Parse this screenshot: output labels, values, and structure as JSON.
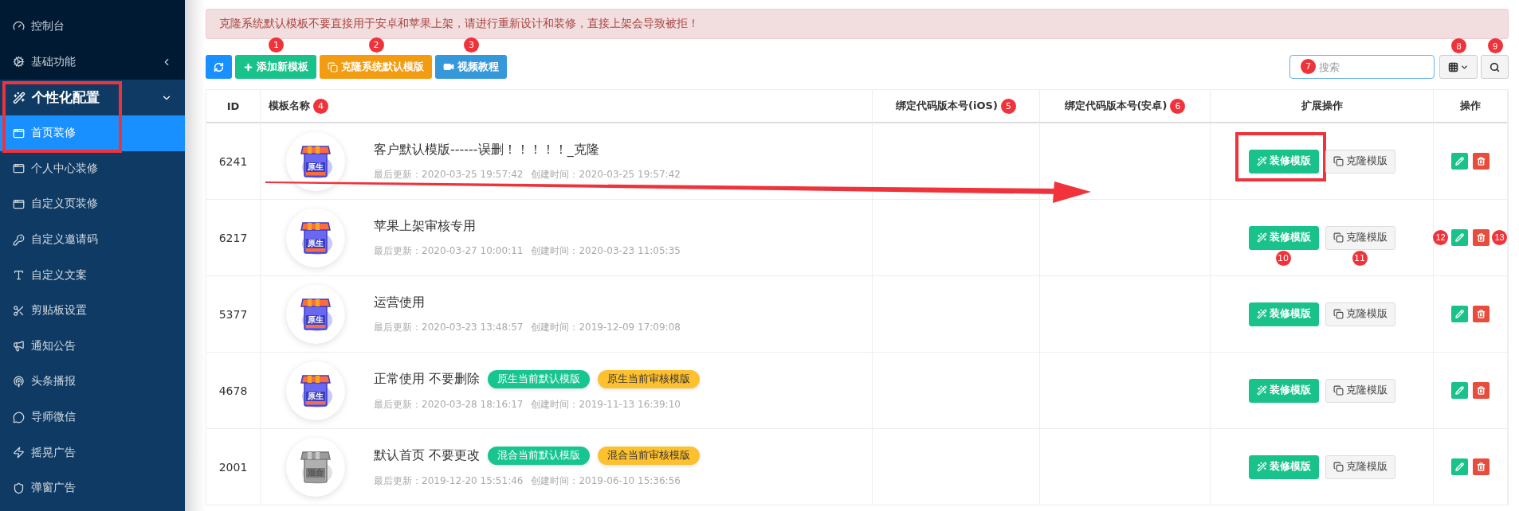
{
  "sidebar": {
    "items": [
      {
        "label": "控制台",
        "selected": false
      },
      {
        "label": "基础功能",
        "selected": false,
        "expanded": false
      },
      {
        "label": "个性化配置",
        "selected": false,
        "expanded": true,
        "highlighted": true,
        "children": [
          {
            "label": "首页装修",
            "selected": true
          },
          {
            "label": "个人中心装修",
            "selected": false
          },
          {
            "label": "自定义页装修",
            "selected": false
          },
          {
            "label": "自定义邀请码",
            "selected": false
          },
          {
            "label": "自定义文案",
            "selected": false
          },
          {
            "label": "剪贴板设置",
            "selected": false
          },
          {
            "label": "通知公告",
            "selected": false
          },
          {
            "label": "头条播报",
            "selected": false
          },
          {
            "label": "导师微信",
            "selected": false
          },
          {
            "label": "摇晃广告",
            "selected": false
          },
          {
            "label": "弹窗广告",
            "selected": false
          }
        ]
      }
    ]
  },
  "alert": "克隆系统默认模板不要直接用于安卓和苹果上架，请进行重新设计和装修，直接上架会导致被拒！",
  "toolbar": {
    "buttons": [
      {
        "kind": "refresh"
      },
      {
        "kind": "add",
        "label": "添加新模板",
        "marker": "1"
      },
      {
        "kind": "clone",
        "label": "克隆系统默认模版",
        "marker": "2"
      },
      {
        "kind": "video",
        "label": "视频教程",
        "marker": "3"
      }
    ],
    "search": {
      "placeholder": "搜索",
      "marker": "7"
    },
    "columns_button": {
      "marker": "8"
    },
    "search_button": {
      "marker": "9"
    }
  },
  "table": {
    "arrow": true,
    "columns": [
      {
        "label": "ID"
      },
      {
        "label": "模板名称",
        "marker": "4"
      },
      {
        "label": "绑定代码版本号(iOS)",
        "marker": "5"
      },
      {
        "label": "绑定代码版本号(安卓)",
        "marker": "6"
      },
      {
        "label": "扩展操作"
      },
      {
        "label": "操作"
      }
    ],
    "rows": [
      {
        "id": "6241",
        "thumbnail": {
          "label": "原生",
          "kind": "color"
        },
        "title": "客户默认模版------误删！！！！！_克隆",
        "updated": "最后更新：2020-03-25 19:57:42",
        "created": "创建时间：2020-03-25 19:57:42",
        "actions": [
          {
            "kind": "decorate",
            "label": "装修模版",
            "highlighted": true
          },
          {
            "kind": "clone",
            "label": "克隆模版"
          }
        ],
        "ops": [
          {
            "kind": "edit"
          },
          {
            "kind": "delete"
          }
        ]
      },
      {
        "id": "6217",
        "thumbnail": {
          "label": "原生",
          "kind": "color"
        },
        "title": "苹果上架审核专用",
        "updated": "最后更新：2020-03-27 10:00:11",
        "created": "创建时间：2020-03-23 11:05:35",
        "actions": [
          {
            "kind": "decorate",
            "label": "装修模版",
            "marker": "10"
          },
          {
            "kind": "clone",
            "label": "克隆模版",
            "marker": "11"
          }
        ],
        "ops": [
          {
            "kind": "edit",
            "marker": "12"
          },
          {
            "kind": "delete",
            "marker": "13"
          }
        ]
      },
      {
        "id": "5377",
        "thumbnail": {
          "label": "原生",
          "kind": "color"
        },
        "title": "运营使用",
        "updated": "最后更新：2020-03-23 13:48:57",
        "created": "创建时间：2019-12-09 17:09:08",
        "actions": [
          {
            "kind": "decorate",
            "label": "装修模版"
          },
          {
            "kind": "clone",
            "label": "克隆模版"
          }
        ],
        "ops": [
          {
            "kind": "edit"
          },
          {
            "kind": "delete"
          }
        ]
      },
      {
        "id": "4678",
        "thumbnail": {
          "label": "原生",
          "kind": "color"
        },
        "title": "正常使用 不要删除",
        "tags": [
          {
            "kind": "default",
            "label": "原生当前默认模版"
          },
          {
            "kind": "review",
            "label": "原生当前审核模版"
          }
        ],
        "updated": "最后更新：2020-03-28 18:16:17",
        "created": "创建时间：2019-11-13 16:39:10",
        "actions": [
          {
            "kind": "decorate",
            "label": "装修模版"
          },
          {
            "kind": "clone",
            "label": "克隆模版"
          }
        ],
        "ops": [
          {
            "kind": "edit"
          },
          {
            "kind": "delete"
          }
        ]
      },
      {
        "id": "2001",
        "thumbnail": {
          "label": "混合",
          "kind": "gray"
        },
        "title": "默认首页 不要更改",
        "tags": [
          {
            "kind": "default",
            "label": "混合当前默认模版"
          },
          {
            "kind": "review",
            "label": "混合当前审核模版"
          }
        ],
        "updated": "最后更新：2019-12-20 15:51:46",
        "created": "创建时间：2019-06-10 15:36:56",
        "actions": [
          {
            "kind": "decorate",
            "label": "装修模版"
          },
          {
            "kind": "clone",
            "label": "克隆模版"
          }
        ],
        "ops": [
          {
            "kind": "edit"
          },
          {
            "kind": "delete"
          }
        ]
      }
    ]
  }
}
